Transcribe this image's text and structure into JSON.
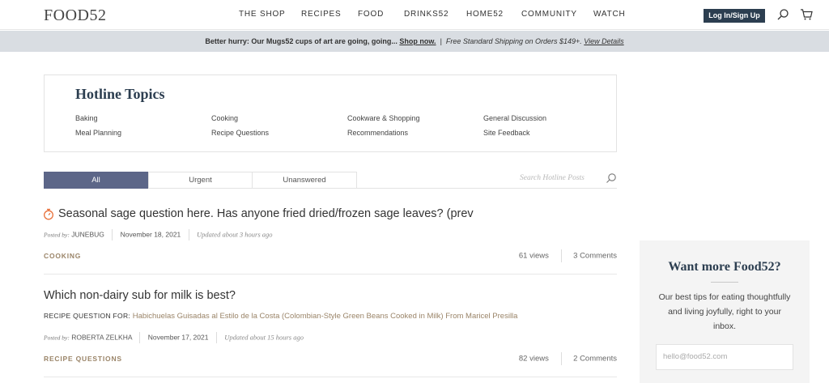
{
  "header": {
    "logo": "FOOD52",
    "nav": [
      "THE SHOP",
      "RECIPES",
      "FOOD",
      "DRINKS52",
      "HOME52",
      "COMMUNITY",
      "WATCH"
    ],
    "login_label": "Log In/Sign Up"
  },
  "promo": {
    "lead": "Better hurry: Our Mugs52 cups of art are going, going...",
    "shop_link": "Shop now.",
    "separator": "|",
    "shipping": "Free Standard Shipping on Orders $149+.",
    "details_link": "View Details"
  },
  "topics": {
    "title": "Hotline Topics",
    "items": [
      "Baking",
      "Cooking",
      "Cookware & Shopping",
      "General Discussion",
      "Meal Planning",
      "Recipe Questions",
      "Recommendations",
      "Site Feedback"
    ]
  },
  "filters": {
    "tabs": [
      "All",
      "Urgent",
      "Unanswered"
    ],
    "active": "All",
    "search_placeholder": "Search Hotline Posts"
  },
  "posts": [
    {
      "title": "Seasonal sage question here. Has anyone fried dried/frozen sage leaves? (prev",
      "posted_by_label": "Posted by:",
      "author": "JUNEBUG",
      "date": "November 18, 2021",
      "updated": "Updated about 3 hours ago",
      "category": "COOKING",
      "views": "61 views",
      "comments": "3 Comments"
    },
    {
      "title": "Which non-dairy sub for milk is best?",
      "recipe_label": "RECIPE QUESTION FOR:",
      "recipe_name": "Habichuelas Guisadas al Estilo de la Costa (Colombian-Style Green Beans Cooked in Milk) From Maricel Presilla",
      "posted_by_label": "Posted by:",
      "author": "ROBERTA ZELKHA",
      "date": "November 17, 2021",
      "updated": "Updated about 15 hours ago",
      "category": "RECIPE QUESTIONS",
      "views": "82 views",
      "comments": "2 Comments"
    }
  ],
  "sidebar": {
    "title": "Want more Food52?",
    "text": "Our best tips for eating thoughtfully and living joyfully, right to your inbox.",
    "email_placeholder": "hello@food52.com"
  },
  "colors": {
    "navy": "#2c3e50",
    "tab_active": "#5c6688",
    "category_tan": "#9a8468",
    "promo_bg": "#d9dde2",
    "timer_orange": "#e8703a"
  }
}
